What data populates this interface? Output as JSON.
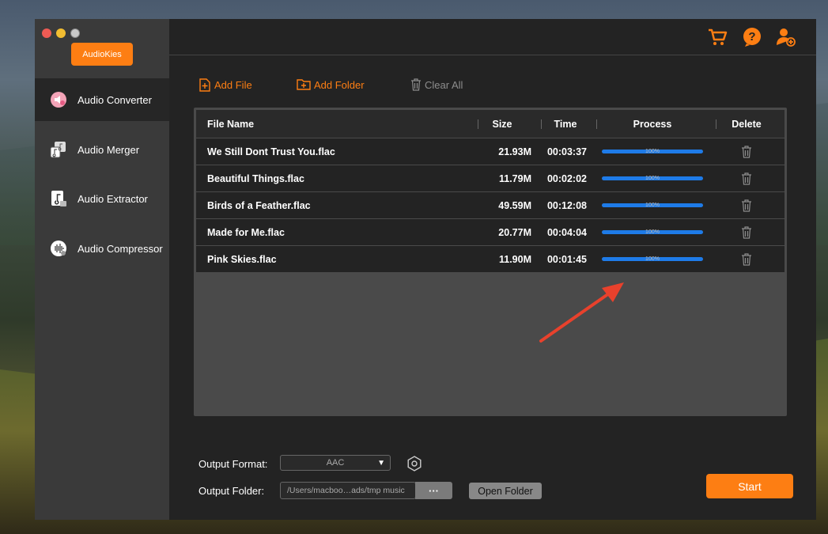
{
  "app": {
    "brand": "AudioKies"
  },
  "sidebar": {
    "items": [
      {
        "label": "Audio Converter",
        "icon": "audio-converter-icon",
        "active": true
      },
      {
        "label": "Audio Merger",
        "icon": "audio-merger-icon",
        "active": false
      },
      {
        "label": "Audio Extractor",
        "icon": "audio-extractor-icon",
        "active": false
      },
      {
        "label": "Audio Compressor",
        "icon": "audio-compressor-icon",
        "active": false
      }
    ]
  },
  "header": {
    "icons": [
      "cart-icon",
      "help-icon",
      "add-user-icon"
    ]
  },
  "toolbar": {
    "add_file": "Add File",
    "add_folder": "Add Folder",
    "clear_all": "Clear All"
  },
  "table": {
    "columns": [
      "File Name",
      "Size",
      "Time",
      "Process",
      "Delete"
    ],
    "rows": [
      {
        "name": "We Still Dont Trust You.flac",
        "size": "21.93M",
        "time": "00:03:37",
        "progress": "100%"
      },
      {
        "name": "Beautiful Things.flac",
        "size": "11.79M",
        "time": "00:02:02",
        "progress": "100%"
      },
      {
        "name": "Birds of a Feather.flac",
        "size": "49.59M",
        "time": "00:12:08",
        "progress": "100%"
      },
      {
        "name": "Made for Me.flac",
        "size": "20.77M",
        "time": "00:04:04",
        "progress": "100%"
      },
      {
        "name": "Pink Skies.flac",
        "size": "11.90M",
        "time": "00:01:45",
        "progress": "100%"
      }
    ]
  },
  "output": {
    "format_label": "Output Format:",
    "format_value": "AAC",
    "folder_label": "Output Folder:",
    "folder_value": "/Users/macboo…ads/tmp music",
    "browse": "···",
    "open_folder": "Open Folder",
    "start": "Start"
  },
  "colors": {
    "accent": "#fd7e13",
    "progress": "#1e7be8",
    "annotation": "#e8412c"
  }
}
